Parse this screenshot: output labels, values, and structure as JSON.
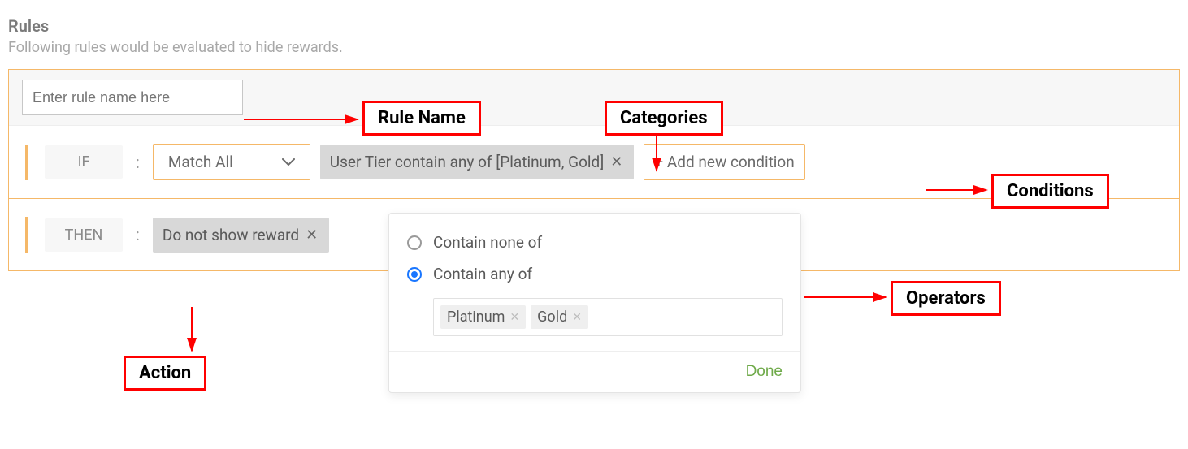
{
  "header": {
    "title": "Rules",
    "subtitle": "Following rules would be evaluated to hide rewards."
  },
  "rule": {
    "name_placeholder": "Enter rule name here",
    "name_value": "",
    "if_label": "IF",
    "then_label": "THEN",
    "colon": ":",
    "match_mode": "Match All",
    "condition_chip": "User Tier contain any of [Platinum, Gold]",
    "add_condition_label": "+ Add new condition",
    "action_chip": "Do not show reward"
  },
  "popover": {
    "option_none": "Contain none of",
    "option_any": "Contain any of",
    "tags": [
      "Platinum",
      "Gold"
    ],
    "done_label": "Done"
  },
  "callouts": {
    "rule_name": "Rule Name",
    "categories": "Categories",
    "conditions": "Conditions",
    "operators": "Operators",
    "action": "Action"
  }
}
